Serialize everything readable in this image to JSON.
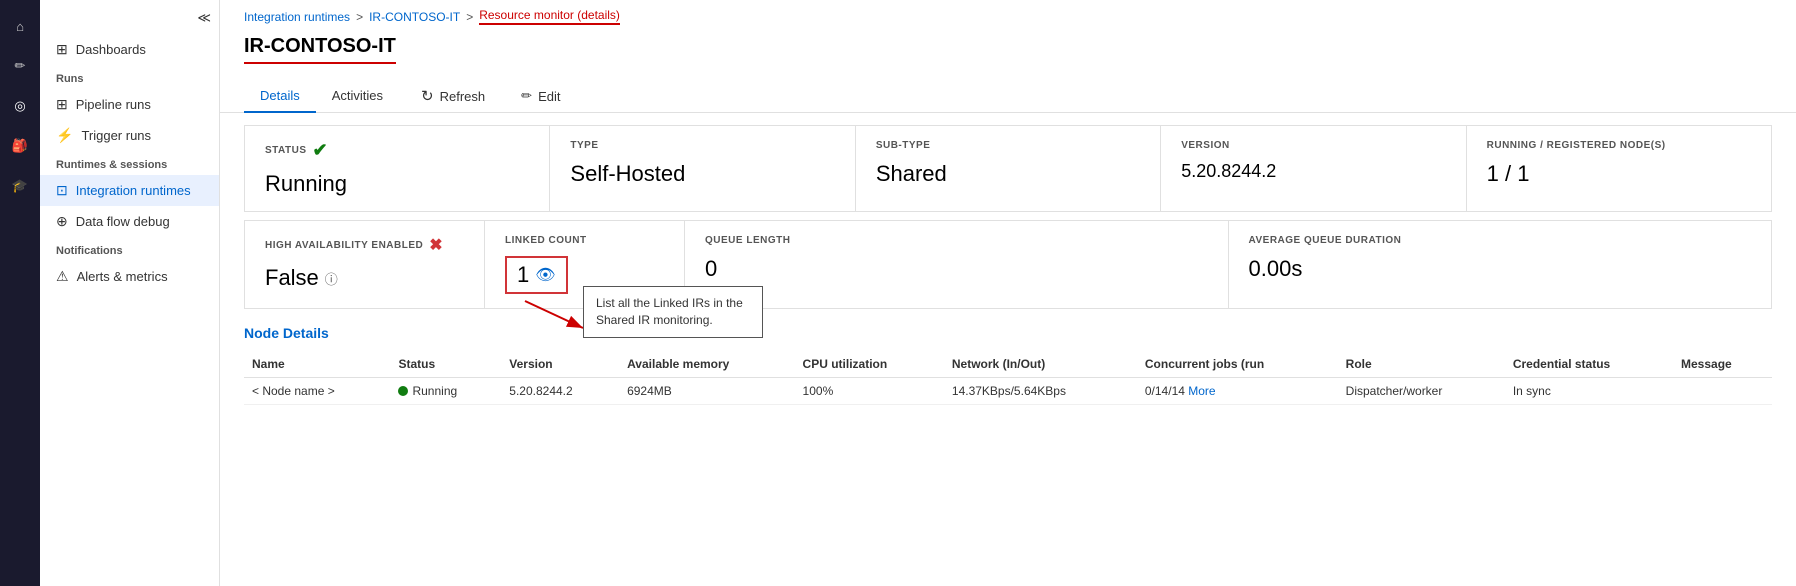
{
  "sidebar": {
    "icons": [
      {
        "name": "home-icon",
        "symbol": "⌂",
        "active": false
      },
      {
        "name": "edit-icon",
        "symbol": "✏",
        "active": false
      },
      {
        "name": "monitor-icon",
        "symbol": "◎",
        "active": true
      },
      {
        "name": "briefcase-icon",
        "symbol": "💼",
        "active": false
      },
      {
        "name": "graduate-icon",
        "symbol": "🎓",
        "active": false
      }
    ],
    "expand_symbol": "≫",
    "collapse_symbol": "≪",
    "sections": [
      {
        "label": "Runs",
        "items": [
          {
            "id": "pipeline-runs",
            "label": "Pipeline runs",
            "icon": "⊞",
            "active": false
          },
          {
            "id": "trigger-runs",
            "label": "Trigger runs",
            "icon": "⚡",
            "active": false
          }
        ]
      },
      {
        "label": "Runtimes & sessions",
        "items": [
          {
            "id": "integration-runtimes",
            "label": "Integration runtimes",
            "icon": "⊡",
            "active": true
          },
          {
            "id": "data-flow-debug",
            "label": "Data flow debug",
            "icon": "⊕",
            "active": false
          }
        ]
      },
      {
        "label": "Notifications",
        "items": [
          {
            "id": "alerts-metrics",
            "label": "Alerts & metrics",
            "icon": "⚠",
            "active": false
          }
        ]
      }
    ]
  },
  "breadcrumb": {
    "items": [
      {
        "label": "Integration runtimes",
        "link": true
      },
      {
        "label": "IR-CONTOSO-IT",
        "link": true
      },
      {
        "label": "Resource monitor (details)",
        "link": false,
        "current": true
      }
    ],
    "separator": ">"
  },
  "page": {
    "title": "IR-CONTOSO-IT"
  },
  "tabs": {
    "items": [
      {
        "id": "details",
        "label": "Details",
        "active": true
      },
      {
        "id": "activities",
        "label": "Activities",
        "active": false
      }
    ],
    "actions": [
      {
        "id": "refresh",
        "label": "Refresh",
        "icon": "↻"
      },
      {
        "id": "edit",
        "label": "Edit",
        "icon": "✏"
      }
    ]
  },
  "cards": {
    "row1": [
      {
        "id": "status",
        "label": "STATUS",
        "value": "Running",
        "has_icon": true,
        "icon_type": "ok"
      },
      {
        "id": "type",
        "label": "TYPE",
        "value": "Self-Hosted",
        "has_icon": false
      },
      {
        "id": "sub-type",
        "label": "SUB-TYPE",
        "value": "Shared",
        "has_icon": false
      },
      {
        "id": "version",
        "label": "VERSION",
        "value": "5.20.8244.2",
        "has_icon": false
      },
      {
        "id": "running-nodes",
        "label": "RUNNING / REGISTERED NODE(S)",
        "value": "1 / 1",
        "has_icon": false
      }
    ],
    "row2": [
      {
        "id": "high-availability",
        "label": "HIGH AVAILABILITY ENABLED",
        "value": "False",
        "has_icon": true,
        "icon_type": "err",
        "has_info": true
      },
      {
        "id": "linked-count",
        "label": "LINKED COUNT",
        "value": "1",
        "has_eye": true,
        "is_linked": true
      },
      {
        "id": "queue-length",
        "label": "QUEUE LENGTH",
        "value": "0",
        "has_icon": false
      },
      {
        "id": "avg-queue-duration",
        "label": "AVERAGE QUEUE DURATION",
        "value": "0.00s",
        "has_icon": false
      }
    ]
  },
  "tooltip": {
    "text": "List all the Linked IRs in the Shared IR monitoring."
  },
  "node_details": {
    "title": "Node Details",
    "columns": [
      "Name",
      "Status",
      "Version",
      "Available memory",
      "CPU utilization",
      "Network (In/Out)",
      "Concurrent jobs (run",
      "Role",
      "Credential status",
      "Message"
    ],
    "rows": [
      {
        "name": "< Node name >",
        "status": "Running",
        "version": "5.20.8244.2",
        "available_memory": "6924MB",
        "cpu_utilization": "100%",
        "network": "14.37KBps/5.64KBps",
        "concurrent_jobs": "0/14/14",
        "more_label": "More",
        "role": "Dispatcher/worker",
        "credential_status": "In sync",
        "message": ""
      }
    ]
  }
}
